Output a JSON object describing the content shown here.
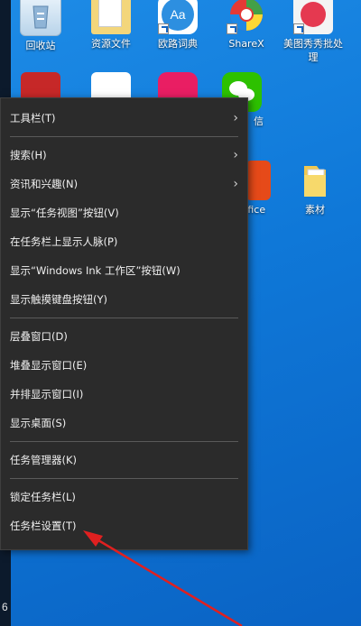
{
  "desktop": {
    "icons": [
      {
        "label": "回收站",
        "icon": "recycle-bin-icon"
      },
      {
        "label": "资源文件",
        "icon": "folder-doc-icon"
      },
      {
        "label": "欧路词典",
        "icon": "dictionary-icon"
      },
      {
        "label": "ShareX",
        "icon": "sharex-icon"
      },
      {
        "label": "美图秀秀批处\n理",
        "icon": "meitu-icon"
      },
      {
        "label": "信",
        "icon": "wechat-icon"
      },
      {
        "label": "Office",
        "icon": "office-icon"
      },
      {
        "label": "素材",
        "icon": "folder-icon"
      }
    ]
  },
  "taskbar": {
    "visible_text": "6"
  },
  "context_menu": {
    "items": [
      {
        "label": "工具栏(T)",
        "submenu": true
      },
      {
        "sep": true
      },
      {
        "label": "搜索(H)",
        "submenu": true
      },
      {
        "label": "资讯和兴趣(N)",
        "submenu": true
      },
      {
        "label": "显示“任务视图”按钮(V)"
      },
      {
        "label": "在任务栏上显示人脉(P)"
      },
      {
        "label": "显示“Windows Ink 工作区”按钮(W)"
      },
      {
        "label": "显示触摸键盘按钮(Y)"
      },
      {
        "sep": true
      },
      {
        "label": "层叠窗口(D)"
      },
      {
        "label": "堆叠显示窗口(E)"
      },
      {
        "label": "并排显示窗口(I)"
      },
      {
        "label": "显示桌面(S)"
      },
      {
        "sep": true
      },
      {
        "label": "任务管理器(K)"
      },
      {
        "sep": true
      },
      {
        "label": "锁定任务栏(L)"
      },
      {
        "label": "任务栏设置(T)"
      }
    ],
    "submenu_glyph": "›"
  },
  "annotation": {
    "color": "#e02020"
  }
}
